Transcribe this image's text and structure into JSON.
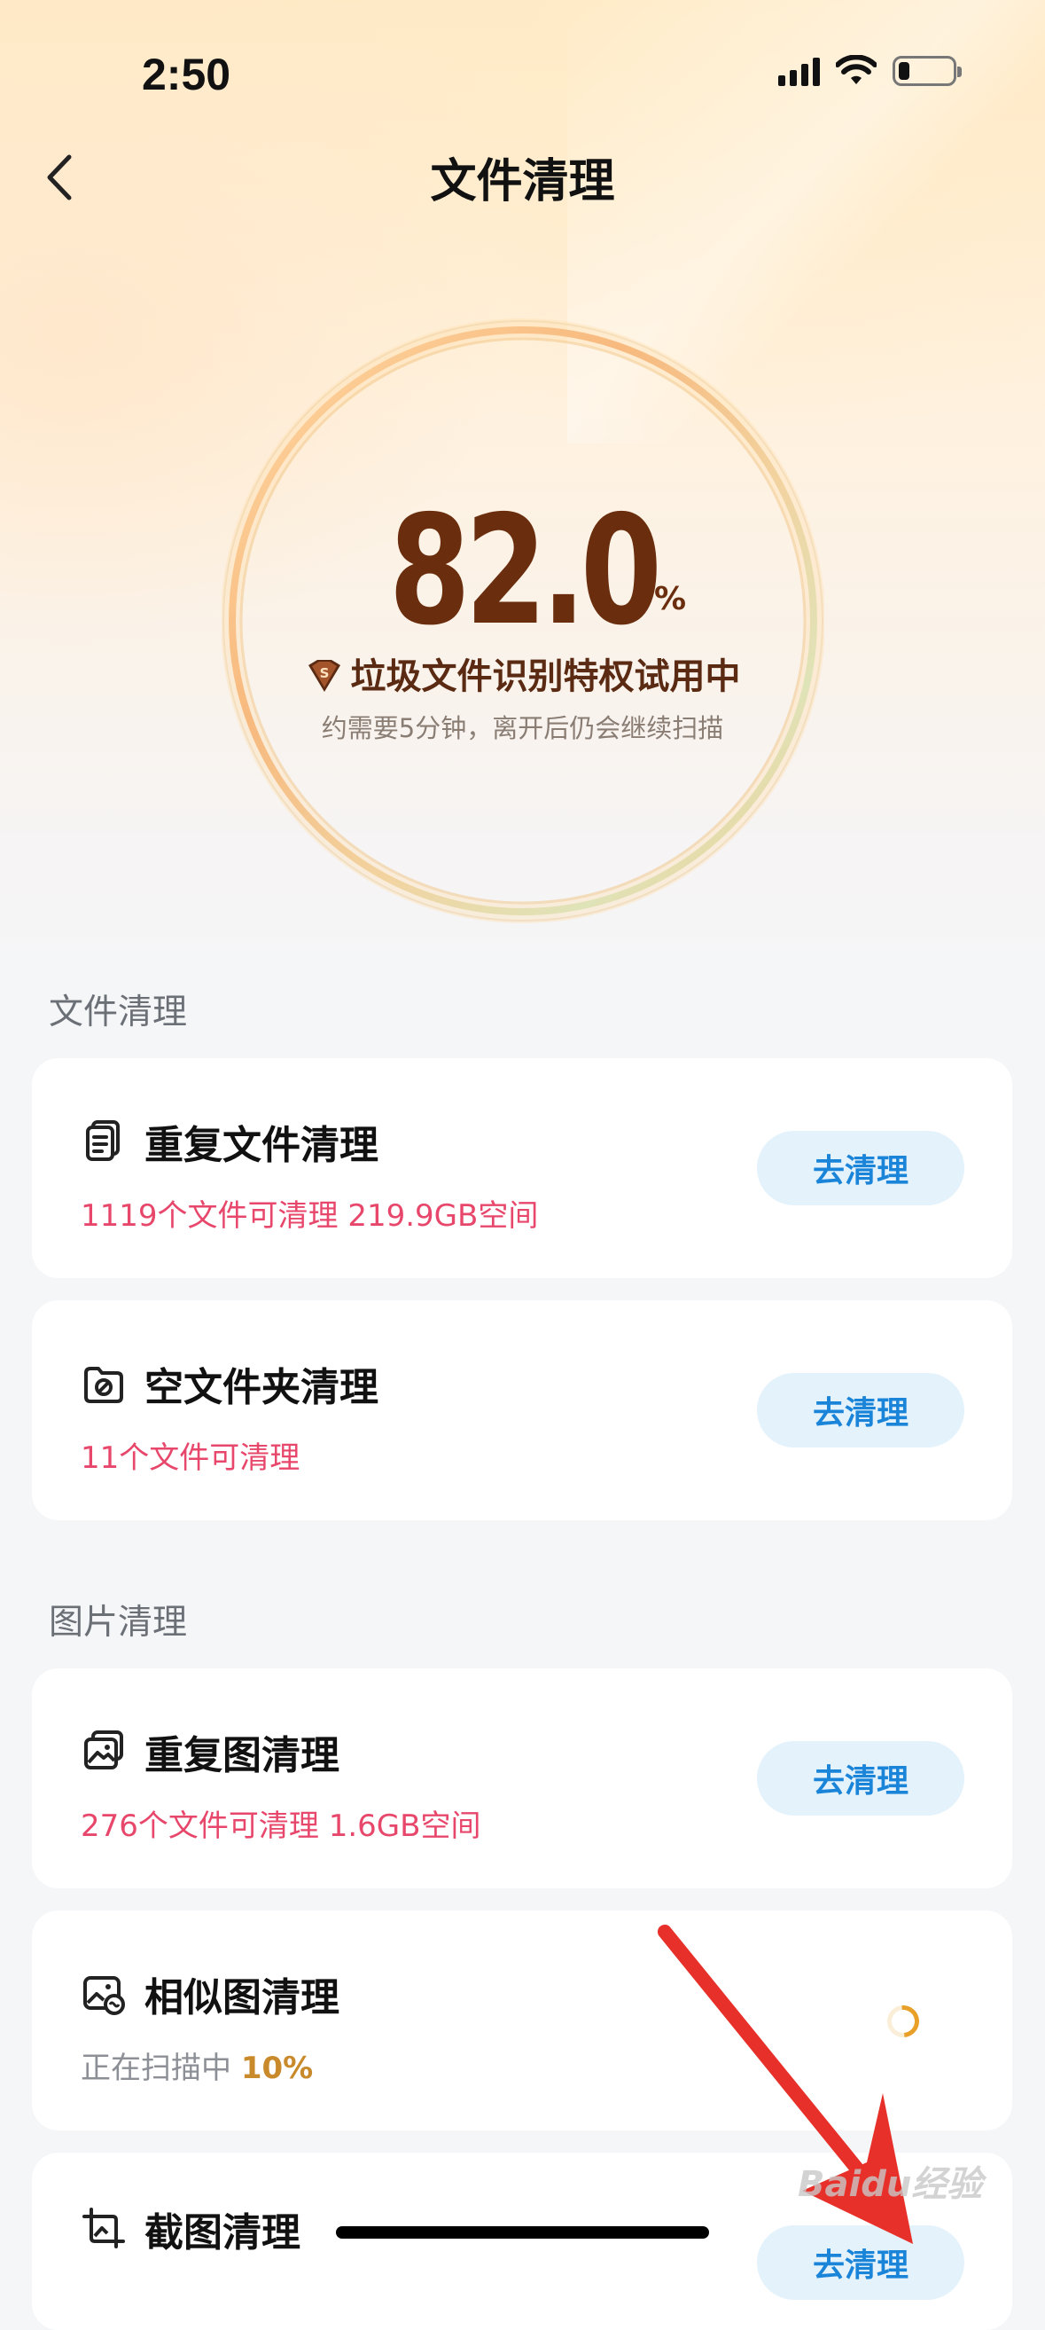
{
  "status_bar": {
    "time": "2:50"
  },
  "nav": {
    "title": "文件清理"
  },
  "scan": {
    "percent": "82.0",
    "unit": "%",
    "privilege_text": "垃圾文件识别特权试用中",
    "badge_letter": "S",
    "hint": "约需要5分钟，离开后仍会继续扫描",
    "progress_fraction": 0.82
  },
  "sections": {
    "files_title": "文件清理",
    "images_title": "图片清理"
  },
  "cards": [
    {
      "title": "重复文件清理",
      "desc": "1119个文件可清理 219.9GB空间",
      "button": "去清理",
      "icon": "documents-icon"
    },
    {
      "title": "空文件夹清理",
      "desc": "11个文件可清理",
      "button": "去清理",
      "icon": "empty-folder-icon"
    },
    {
      "title": "重复图清理",
      "desc": "276个文件可清理 1.6GB空间",
      "button": "去清理",
      "icon": "images-icon"
    },
    {
      "title": "相似图清理",
      "desc_prefix": "正在扫描中 ",
      "desc_percent": "10%",
      "icon": "similar-image-icon"
    },
    {
      "title": "截图清理",
      "button": "去清理",
      "icon": "screenshot-icon"
    }
  ],
  "watermark": "Baidu经验",
  "colors": {
    "accent_blue": "#1a84d9",
    "alert_pink": "#e8476c",
    "score_brown": "#6a2d0d",
    "arrow_red": "#e8302a"
  }
}
